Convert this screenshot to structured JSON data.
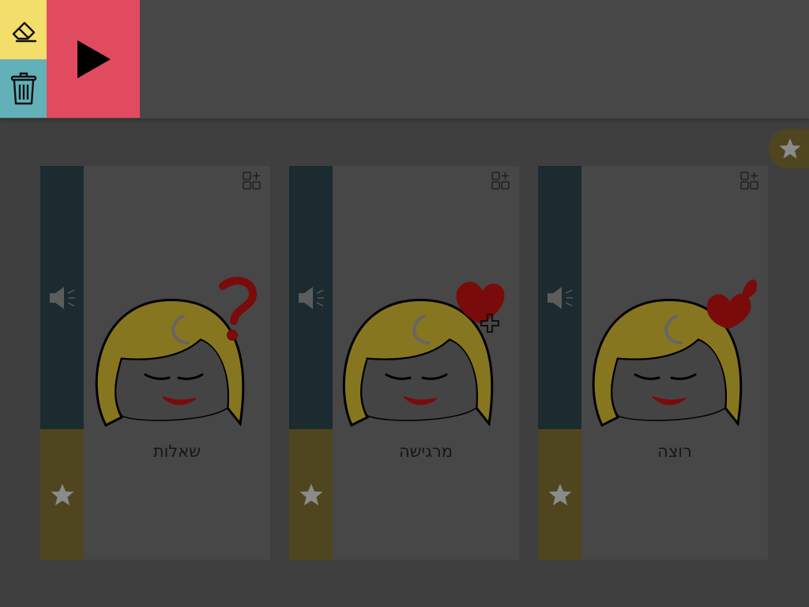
{
  "colors": {
    "background": "#3f3f3f",
    "toolbar": "#474747",
    "erase_button": "#f4de6b",
    "trash_button": "#63b1b8",
    "play_button": "#e14b5f",
    "card_background": "#474747",
    "card_audio_strip": "#1b2b30",
    "card_star_strip": "#4f4620",
    "favorites_tab": "#4f4620",
    "hair": "#877620",
    "face": "#444444",
    "symbol_red": "#7a0b0b"
  },
  "toolbar": {
    "erase_icon": "eraser-icon",
    "trash_icon": "trash-icon",
    "play_icon": "play-icon"
  },
  "favorites": {
    "icon": "star-icon"
  },
  "cards": [
    {
      "label": "שאלות",
      "symbol": "question-mark-icon"
    },
    {
      "label": "מרגישה",
      "symbol": "heart-plus-icon"
    },
    {
      "label": "רוצה",
      "symbol": "heart-icon"
    }
  ]
}
